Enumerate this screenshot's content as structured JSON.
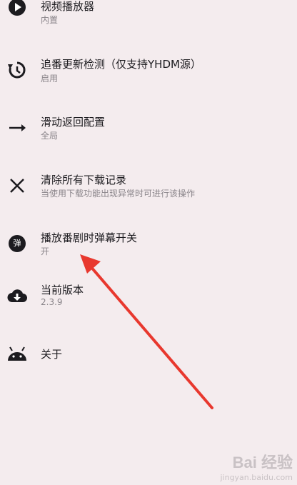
{
  "settings": {
    "items": [
      {
        "title": "视频播放器",
        "subtitle": "内置",
        "icon": "play-circle-icon"
      },
      {
        "title": "追番更新检测（仅支持YHDM源）",
        "subtitle": "启用",
        "icon": "update-icon"
      },
      {
        "title": "滑动返回配置",
        "subtitle": "全局",
        "icon": "arrow-right-icon"
      },
      {
        "title": "清除所有下载记录",
        "subtitle": "当使用下载功能出现异常时可进行该操作",
        "icon": "close-icon"
      },
      {
        "title": "播放番剧时弹幕开关",
        "subtitle": "开",
        "icon": "danmaku-icon",
        "icon_text": "弹"
      },
      {
        "title": "当前版本",
        "subtitle": "2.3.9",
        "icon": "cloud-download-icon"
      },
      {
        "title": "关于",
        "icon": "android-icon"
      }
    ]
  },
  "annotation": {
    "color": "#e8382e"
  },
  "watermark": {
    "brand": "Bai 经验",
    "url": "jingyan.baidu.com"
  }
}
